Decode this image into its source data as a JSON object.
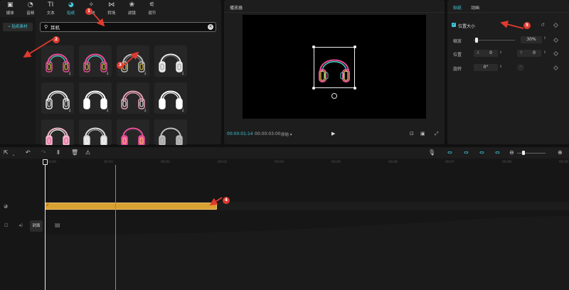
{
  "top_tabs": [
    {
      "label": "媒体",
      "icon": "media-icon"
    },
    {
      "label": "音频",
      "icon": "audio-icon"
    },
    {
      "label": "文本",
      "icon": "text-icon"
    },
    {
      "label": "贴纸",
      "icon": "sticker-icon",
      "active": true
    },
    {
      "label": "特效",
      "icon": "effects-icon"
    },
    {
      "label": "转场",
      "icon": "transition-icon"
    },
    {
      "label": "滤镜",
      "icon": "filter-icon"
    },
    {
      "label": "调节",
      "icon": "adjust-icon"
    }
  ],
  "sidebar": {
    "item": "• 贴纸素材"
  },
  "search": {
    "value": "耳机",
    "placeholder": ""
  },
  "player": {
    "title": "播放器",
    "time_current": "00:00:01:14",
    "time_total": "00:00:03:00",
    "ratio_label": "原始 ▾"
  },
  "props": {
    "tabs": [
      "贴纸",
      "动画"
    ],
    "section": "位置大小",
    "scale_label": "缩放",
    "scale_value": "30%",
    "scale_fraction": 0.03,
    "position_label": "位置",
    "pos_x_label": "X",
    "pos_x": "0",
    "pos_y_label": "Y",
    "pos_y": "0",
    "rotation_label": "旋转",
    "rotation": "0°"
  },
  "timeline": {
    "ruler": [
      "00:00",
      "00:01",
      "00:02",
      "00:03",
      "00:04",
      "00:05",
      "00:06",
      "00:07",
      "00:08",
      "00:09"
    ],
    "cover_label": "封面"
  },
  "annotations": [
    "1",
    "2",
    "3",
    "4",
    "5"
  ],
  "colors": {
    "accent": "#3fc6d8",
    "clip": "#d9a032",
    "marker": "#e03a2f"
  }
}
